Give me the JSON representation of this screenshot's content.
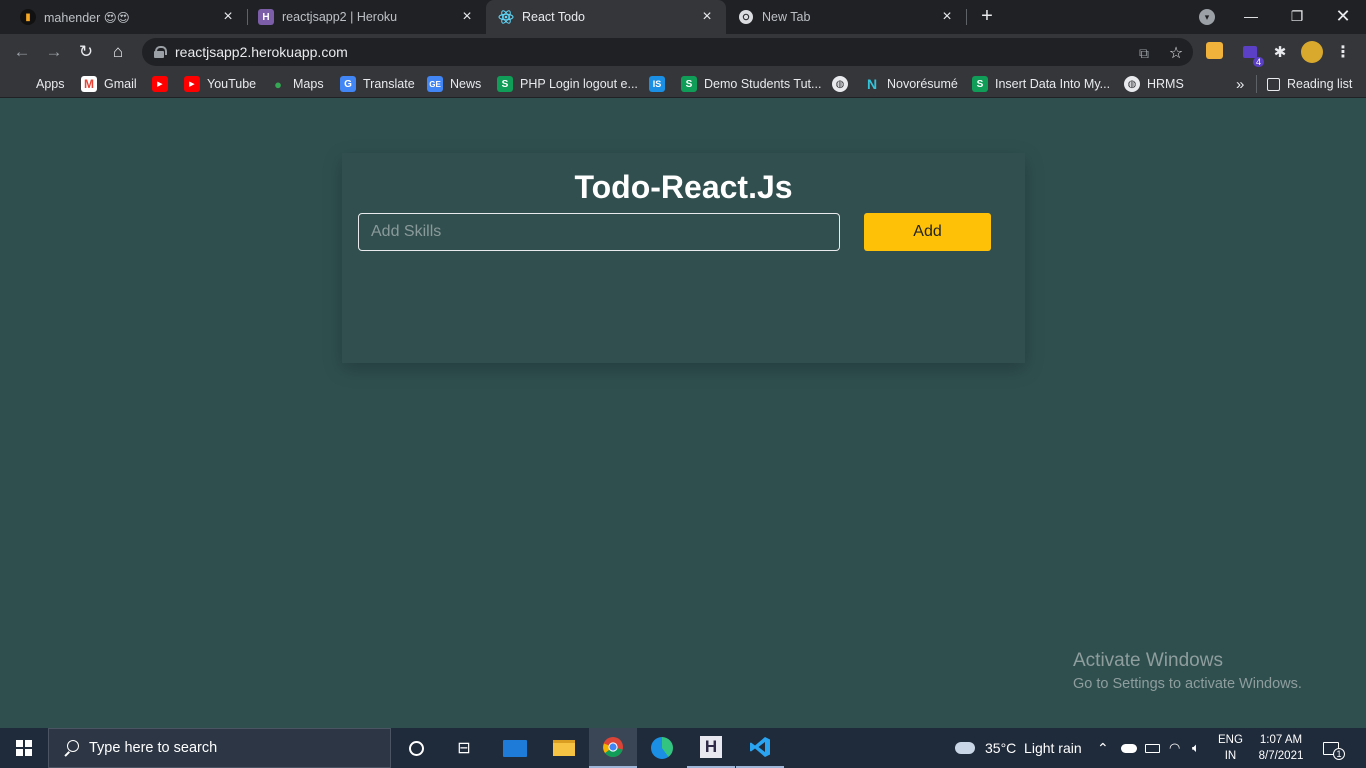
{
  "browser": {
    "tabs": [
      {
        "title": "mahender 😍😍",
        "active": false
      },
      {
        "title": "reactjsapp2 | Heroku",
        "active": false
      },
      {
        "title": "React Todo",
        "active": true
      },
      {
        "title": "New Tab",
        "active": false
      }
    ],
    "url": "reactjsapp2.herokuapp.com",
    "bookmarks": [
      {
        "label": "Apps",
        "icon": "apps-grid-icon"
      },
      {
        "label": "Gmail",
        "icon": "gmail-icon"
      },
      {
        "label": "",
        "icon": "youtube-icon"
      },
      {
        "label": "YouTube",
        "icon": "youtube-icon"
      },
      {
        "label": "Maps",
        "icon": "maps-pin-icon"
      },
      {
        "label": "Translate",
        "icon": "translate-icon"
      },
      {
        "label": "News",
        "icon": "news-icon"
      },
      {
        "label": "PHP Login logout e...",
        "icon": "s-icon"
      },
      {
        "label": "",
        "icon": "is-icon"
      },
      {
        "label": "Demo Students Tut...",
        "icon": "s-icon"
      },
      {
        "label": "",
        "icon": "globe-icon"
      },
      {
        "label": "Novorésumé",
        "icon": "novoresume-icon"
      },
      {
        "label": "Insert Data Into My...",
        "icon": "s-icon"
      },
      {
        "label": "HRMS",
        "icon": "globe-icon"
      }
    ],
    "overflow_glyph": "»",
    "reading_list": "Reading list",
    "extension_badge": "4"
  },
  "app": {
    "title": "Todo-React.Js",
    "input_placeholder": "Add Skills",
    "input_value": "",
    "add_label": "Add"
  },
  "watermark": {
    "line1": "Activate Windows",
    "line2": "Go to Settings to activate Windows."
  },
  "taskbar": {
    "search_placeholder": "Type here to search",
    "weather": "35°C  Light rain",
    "lang_top": "ENG",
    "lang_bottom": "IN",
    "time": "1:07 AM",
    "date": "8/7/2021",
    "notification_count": "1"
  },
  "colors": {
    "page_bg": "#2f4f4f",
    "card_bg": "#324f4f",
    "add_button": "#ffc107",
    "chrome_dark": "#202124",
    "chrome_toolbar": "#35363a",
    "taskbar": "#1f2a3a"
  }
}
